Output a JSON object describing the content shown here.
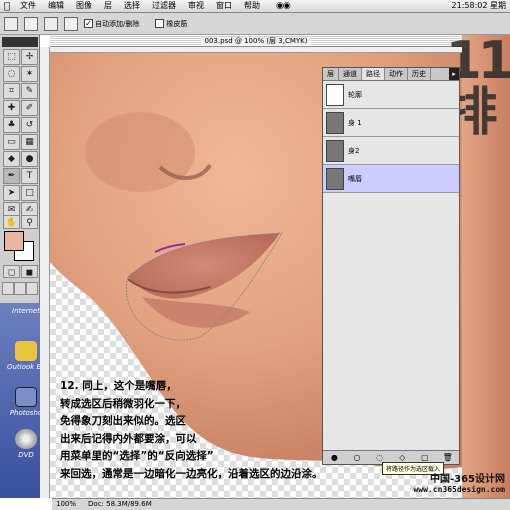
{
  "menubar": {
    "items": [
      "文件",
      "编辑",
      "图像",
      "层",
      "选择",
      "过滤器",
      "审视",
      "窗口",
      "帮助"
    ],
    "clock": "21:58:02 星期"
  },
  "options": {
    "auto_add_label": "自动添加/删除",
    "rubber_band_label": "橡皮筋"
  },
  "document": {
    "title": "003.psd @ 100% (层 3,CMYK)"
  },
  "desktop": {
    "icons": [
      {
        "label": "Internet"
      },
      {
        "label": "Outlook Ex"
      },
      {
        "label": "Photosho"
      },
      {
        "label": "DVD"
      }
    ]
  },
  "paths_palette": {
    "tabs": [
      "层",
      "通道",
      "路径",
      "动作",
      "历史"
    ],
    "active_tab": "路径",
    "paths": [
      {
        "name": "轮廓",
        "selected": false
      },
      {
        "name": "身 1",
        "selected": false
      },
      {
        "name": "身2",
        "selected": false
      },
      {
        "name": "嘴唇",
        "selected": true
      }
    ],
    "tooltip": "将路径作为选区载入"
  },
  "note": {
    "lines": [
      "12. 同上，这个是嘴唇，",
      "转成选区后稍微羽化一下，",
      "免得象刀刻出来似的。选区",
      "出来后记得内外都要涂，可以",
      "用菜单里的“选择”的“反向选择”",
      "来回选，通常是一边暗化一边亮化，沿着选区的边沿涂。"
    ]
  },
  "status": {
    "zoom": "100%",
    "doc": "Doc: 58.3M/89.6M"
  },
  "watermark": {
    "line1": "中国-365设计网",
    "line2": "www.cn365design.com"
  },
  "colors": {
    "foreground": "#e8b59e",
    "background": "#ffffff",
    "skin": "#e2a27f",
    "selected_path": "#ccccff"
  }
}
